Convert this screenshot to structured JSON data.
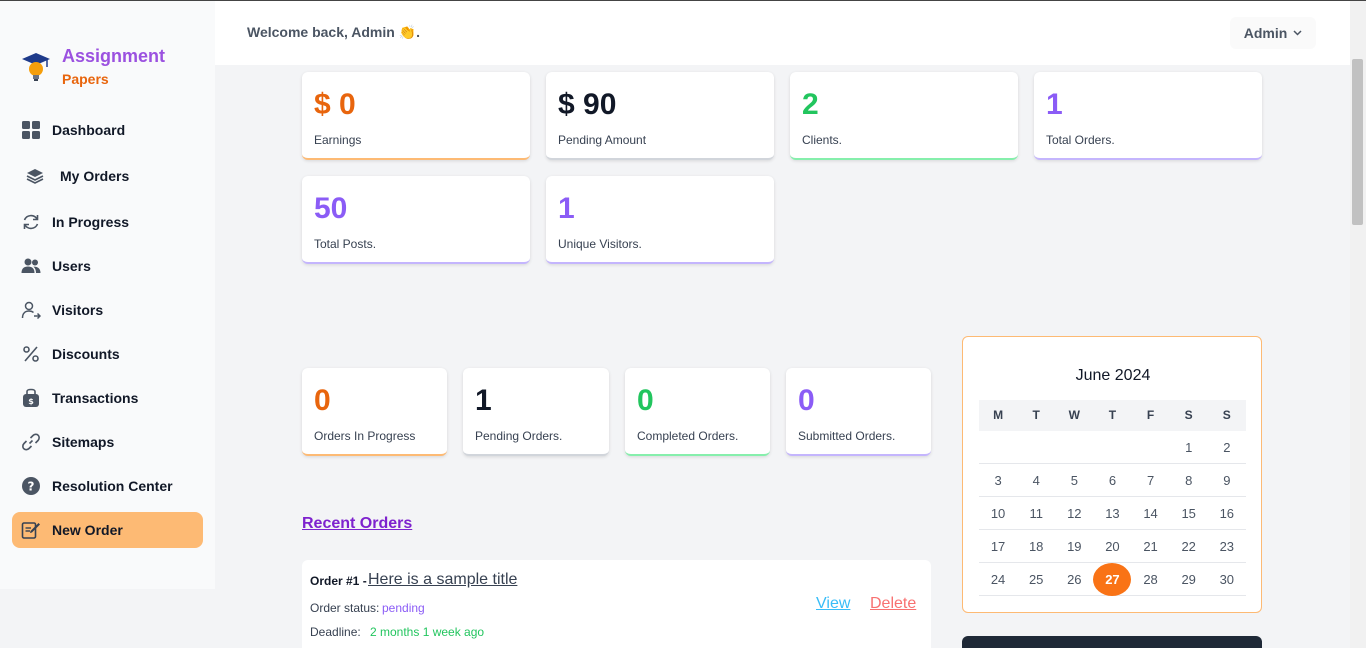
{
  "brand": {
    "title": "Assignment",
    "subtitle": "Papers",
    "logo_icon": "graduation-lightbulb-icon"
  },
  "sidebar": {
    "items": [
      {
        "label": "Dashboard",
        "icon": "grid-icon"
      },
      {
        "label": "My Orders",
        "icon": "layers-icon"
      },
      {
        "label": "In Progress",
        "icon": "refresh-icon"
      },
      {
        "label": "Users",
        "icon": "users-icon"
      },
      {
        "label": "Visitors",
        "icon": "user-arrow-icon"
      },
      {
        "label": "Discounts",
        "icon": "percent-icon"
      },
      {
        "label": "Transactions",
        "icon": "money-bag-icon"
      },
      {
        "label": "Sitemaps",
        "icon": "link-icon"
      },
      {
        "label": "Resolution Center",
        "icon": "help-icon"
      },
      {
        "label": "New Order",
        "icon": "edit-note-icon",
        "active": true
      }
    ]
  },
  "header": {
    "welcome": "Welcome back, Admin 👏.",
    "admin_label": "Admin"
  },
  "stats_top": [
    {
      "value": "$ 0",
      "label": "Earnings",
      "accent": "#e8650d"
    },
    {
      "value": "$ 90",
      "label": "Pending Amount",
      "accent": "#111827"
    },
    {
      "value": "2",
      "label": "Clients.",
      "accent": "#22c55e"
    },
    {
      "value": "1",
      "label": "Total Orders.",
      "accent": "#8b5cf6"
    },
    {
      "value": "50",
      "label": "Total Posts.",
      "accent": "#8b5cf6"
    },
    {
      "value": "1",
      "label": "Unique Visitors.",
      "accent": "#8b5cf6"
    }
  ],
  "stats_orders": [
    {
      "value": "0",
      "label": "Orders In Progress",
      "accent": "#e8650d"
    },
    {
      "value": "1",
      "label": "Pending Orders.",
      "accent": "#111827"
    },
    {
      "value": "0",
      "label": "Completed Orders.",
      "accent": "#22c55e"
    },
    {
      "value": "0",
      "label": "Submitted Orders.",
      "accent": "#8b5cf6"
    }
  ],
  "calendar": {
    "title": "June 2024",
    "weekdays": [
      "M",
      "T",
      "W",
      "T",
      "F",
      "S",
      "S"
    ],
    "weeks": [
      [
        "",
        "",
        "",
        "",
        "",
        "1",
        "2"
      ],
      [
        "3",
        "4",
        "5",
        "6",
        "7",
        "8",
        "9"
      ],
      [
        "10",
        "11",
        "12",
        "13",
        "14",
        "15",
        "16"
      ],
      [
        "17",
        "18",
        "19",
        "20",
        "21",
        "22",
        "23"
      ],
      [
        "24",
        "25",
        "26",
        "27",
        "28",
        "29",
        "30"
      ]
    ],
    "today": "27"
  },
  "recent": {
    "heading": "Recent Orders",
    "order": {
      "number": "Order #1 -",
      "title": "Here is a sample title",
      "status_label": "Order status:",
      "status": "pending",
      "deadline_label": "Deadline:",
      "deadline": "2 months 1 week ago",
      "view_label": "View",
      "delete_label": "Delete"
    }
  }
}
